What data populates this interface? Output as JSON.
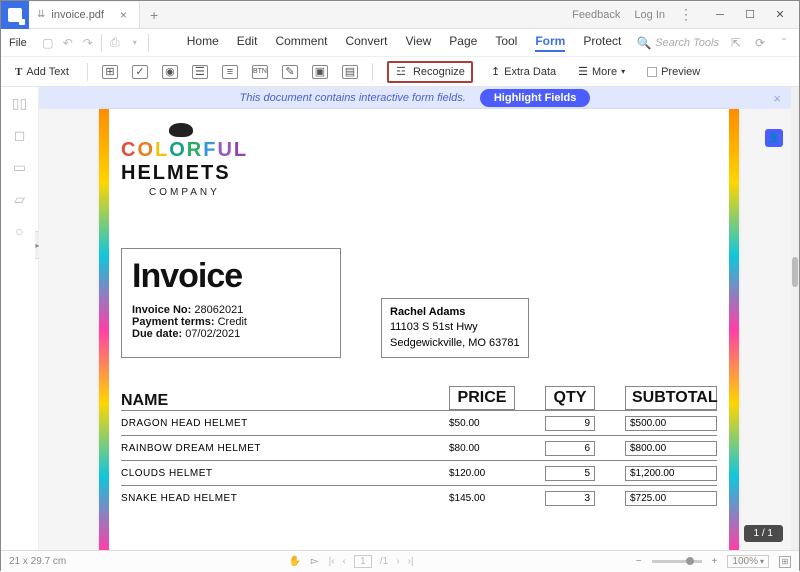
{
  "titlebar": {
    "tab_name": "invoice.pdf",
    "feedback": "Feedback",
    "login": "Log In"
  },
  "menubar": {
    "file": "File",
    "tabs": [
      "Home",
      "Edit",
      "Comment",
      "Convert",
      "View",
      "Page",
      "Tool",
      "Form",
      "Protect"
    ],
    "active_index": 7,
    "search_placeholder": "Search Tools"
  },
  "ribbon": {
    "add_text": "Add Text",
    "recognize": "Recognize",
    "extra_data": "Extra Data",
    "more": "More",
    "preview": "Preview"
  },
  "info_bar": {
    "message": "This document contains interactive form fields.",
    "pill": "Highlight Fields"
  },
  "document": {
    "brand_line1": "COLORFUL",
    "brand_line2": "HELMETS",
    "brand_sub": "COMPANY",
    "invoice_title": "Invoice",
    "inv_no_label": "Invoice No:",
    "inv_no": "28062021",
    "pay_label": "Payment terms:",
    "pay_val": "Credit",
    "due_label": "Due date:",
    "due_val": "07/02/2021",
    "customer": {
      "name": "Rachel Adams",
      "addr1": "11103 S 51st Hwy",
      "addr2": "Sedgewickville, MO 63781"
    },
    "columns": {
      "name": "NAME",
      "price": "PRICE",
      "qty": "QTY",
      "subtotal": "SUBTOTAL"
    },
    "rows": [
      {
        "name": "DRAGON HEAD HELMET",
        "price": "$50.00",
        "qty": "9",
        "subtotal": "$500.00"
      },
      {
        "name": "RAINBOW DREAM HELMET",
        "price": "$80.00",
        "qty": "6",
        "subtotal": "$800.00"
      },
      {
        "name": "CLOUDS HELMET",
        "price": "$120.00",
        "qty": "5",
        "subtotal": "$1,200.00"
      },
      {
        "name": "SNAKE HEAD HELMET",
        "price": "$145.00",
        "qty": "3",
        "subtotal": "$725.00"
      }
    ]
  },
  "page_counter": "1 / 1",
  "statusbar": {
    "dims": "21 x 29.7 cm",
    "page_current": "1",
    "page_total": "/1",
    "zoom": "100%"
  }
}
